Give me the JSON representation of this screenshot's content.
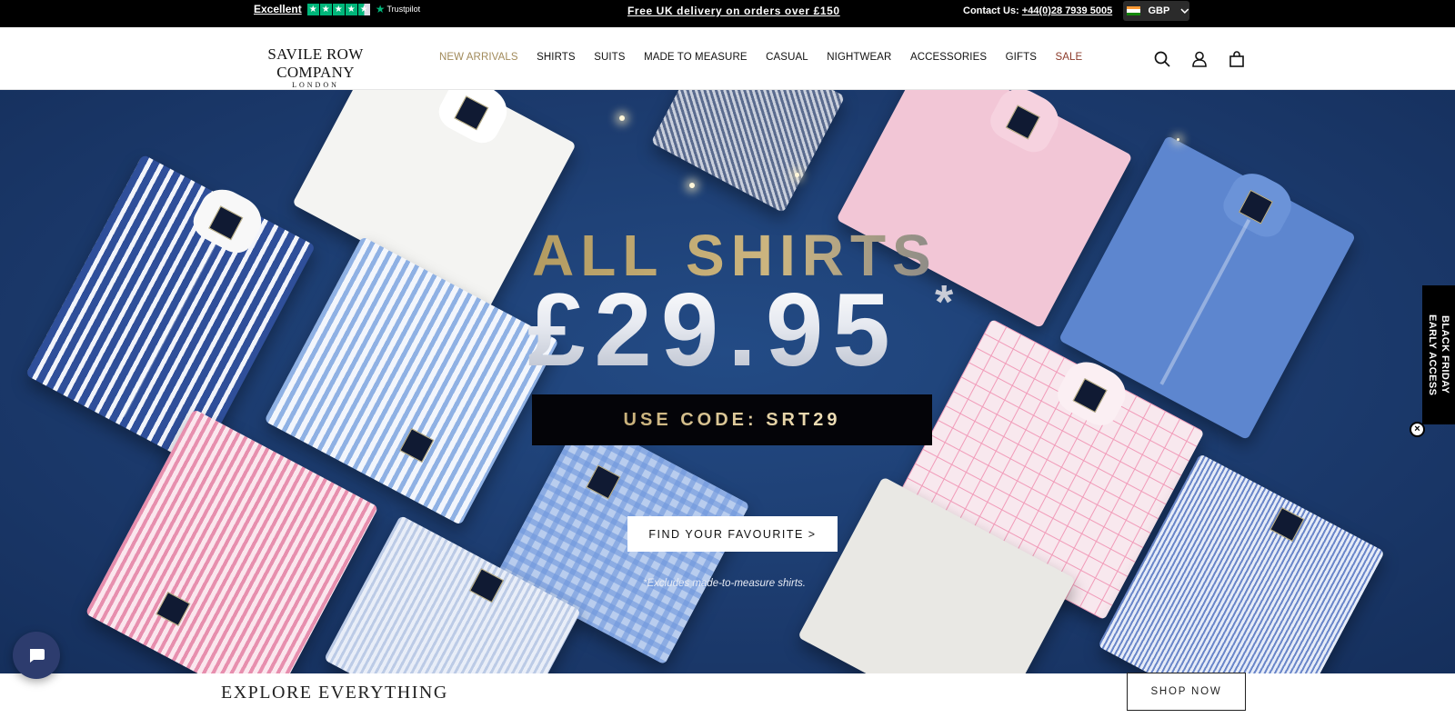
{
  "topbar": {
    "trustpilot_label": "Excellent",
    "trustpilot_brand": "Trustpilot",
    "promo": "Free UK delivery on orders over £150",
    "contact_label": "Contact Us:",
    "contact_phone": "+44(0)28 7939 5005",
    "currency": "GBP"
  },
  "header": {
    "logo_main": "SAVILE ROW COMPANY",
    "logo_sub": "LONDON",
    "nav": [
      "NEW ARRIVALS",
      "SHIRTS",
      "SUITS",
      "MADE TO MEASURE",
      "CASUAL",
      "NIGHTWEAR",
      "ACCESSORIES",
      "GIFTS",
      "SALE"
    ]
  },
  "hero": {
    "title": "ALL SHIRTS",
    "price": "£29.95",
    "price_star": "*",
    "code": "USE CODE: SRT29",
    "cta": "FIND YOUR FAVOURITE >",
    "exclusion": "*Excludes made-to-measure shirts."
  },
  "side_tab": {
    "line1": "BLACK FRIDAY",
    "line2": "EARLY ACCESS"
  },
  "explore": {
    "title": "EXPLORE EVERYTHING",
    "button": "SHOP NOW"
  },
  "colors": {
    "hero_bg": "#1c3b6e",
    "nav_gold": "#a18a5a",
    "sale": "#8b3a2a",
    "trustpilot_green": "#00b67a"
  }
}
